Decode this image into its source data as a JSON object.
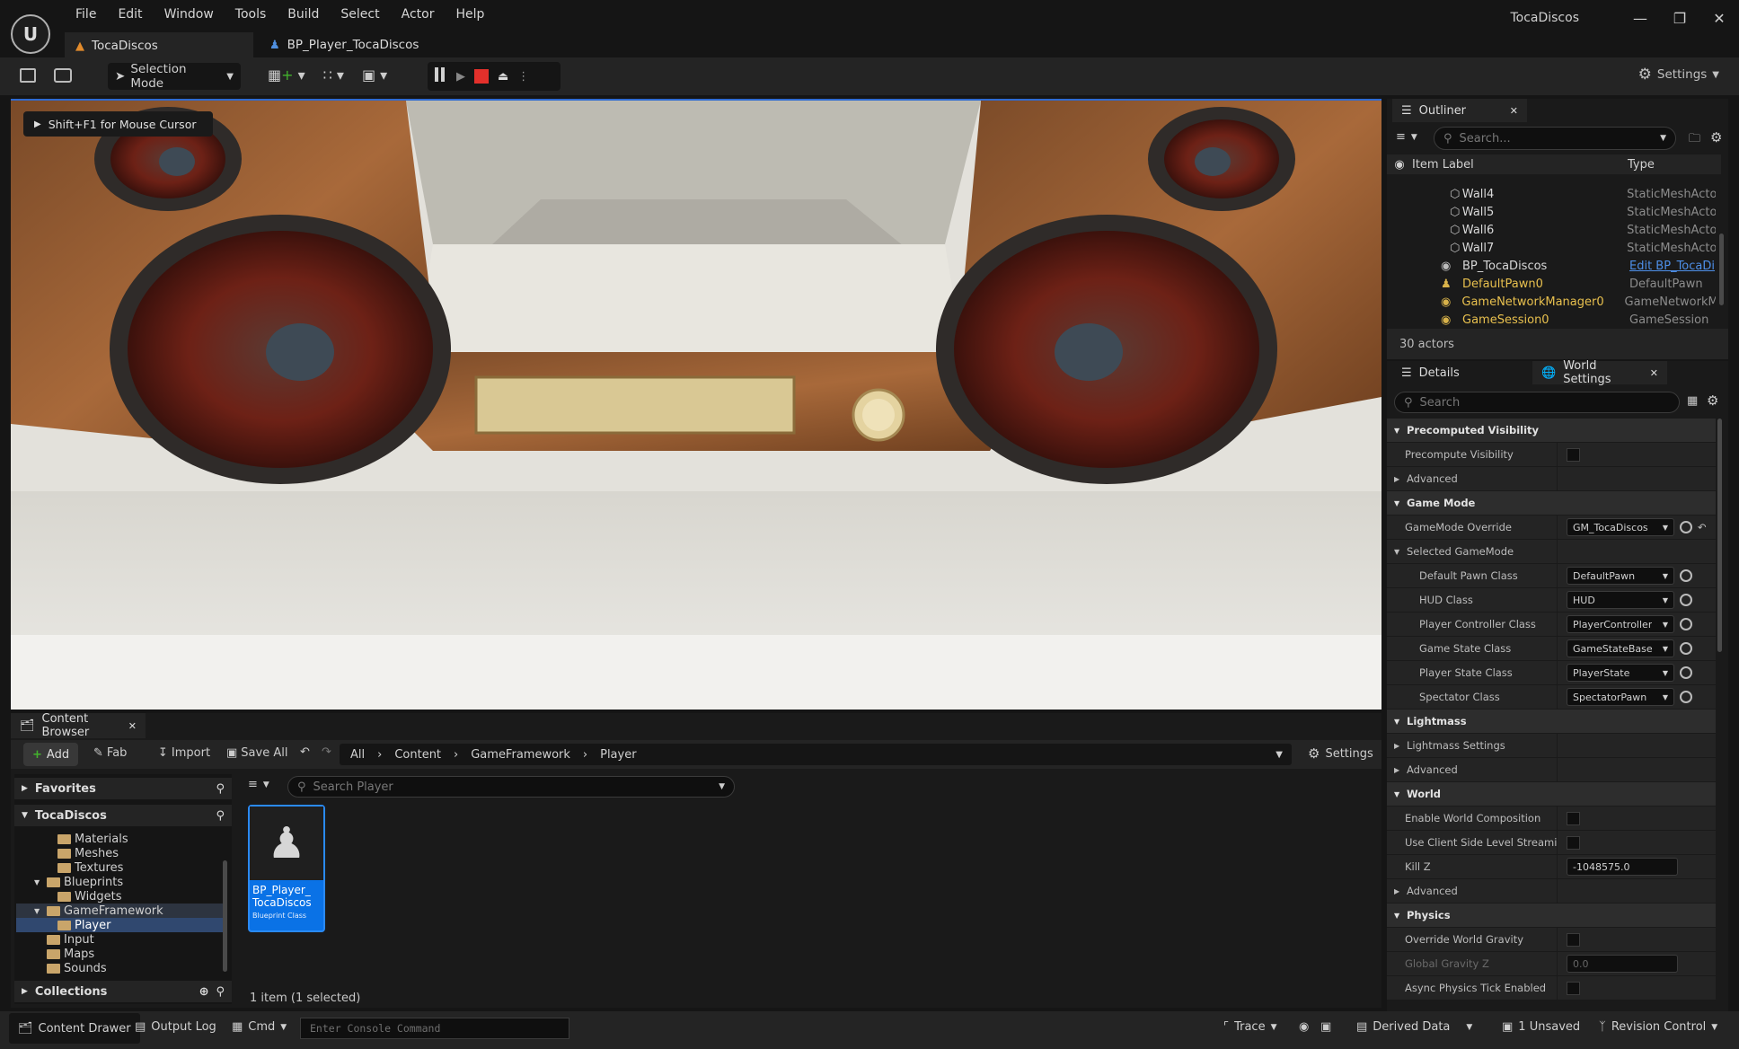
{
  "app": {
    "title": "TocaDiscos",
    "menu": [
      "File",
      "Edit",
      "Window",
      "Tools",
      "Build",
      "Select",
      "Actor",
      "Help"
    ],
    "logo": "unreal-logo"
  },
  "tabs": [
    {
      "label": "TocaDiscos",
      "icon": "level-icon",
      "active": true
    },
    {
      "label": "BP_Player_TocaDiscos",
      "icon": "blueprint-icon",
      "active": false
    }
  ],
  "toolbar": {
    "mode_label": "Selection Mode",
    "settings_label": "Settings"
  },
  "viewport": {
    "hint": "Shift+F1 for Mouse Cursor"
  },
  "outliner": {
    "tab_label": "Outliner",
    "search_placeholder": "Search...",
    "col_label": "Item Label",
    "col_type": "Type",
    "rows": [
      {
        "label": "Wall4",
        "type": "StaticMeshActo"
      },
      {
        "label": "Wall5",
        "type": "StaticMeshActo"
      },
      {
        "label": "Wall6",
        "type": "StaticMeshActo"
      },
      {
        "label": "Wall7",
        "type": "StaticMeshActo"
      },
      {
        "label": "BP_TocaDiscos",
        "type": "Edit BP_TocaDi"
      },
      {
        "label": "DefaultPawn0",
        "type": "DefaultPawn"
      },
      {
        "label": "GameNetworkManager0",
        "type": "GameNetworkM"
      },
      {
        "label": "GameSession0",
        "type": "GameSession"
      }
    ],
    "count": "30 actors"
  },
  "details": {
    "tab_details": "Details",
    "tab_world": "World Settings",
    "search_placeholder": "Search",
    "rows": [
      {
        "kind": "section",
        "label": "Precomputed Visibility"
      },
      {
        "kind": "check",
        "label": "Precompute Visibility"
      },
      {
        "kind": "collapsed",
        "label": "Advanced"
      },
      {
        "kind": "section",
        "label": "Game Mode"
      },
      {
        "kind": "dropdown",
        "label": "GameMode Override",
        "value": "GM_TocaDiscos"
      },
      {
        "kind": "group",
        "label": "Selected GameMode"
      },
      {
        "kind": "dropdown",
        "label": "Default Pawn Class",
        "value": "DefaultPawn",
        "indent": true
      },
      {
        "kind": "dropdown",
        "label": "HUD Class",
        "value": "HUD",
        "indent": true
      },
      {
        "kind": "dropdown",
        "label": "Player Controller Class",
        "value": "PlayerController",
        "indent": true
      },
      {
        "kind": "dropdown",
        "label": "Game State Class",
        "value": "GameStateBase",
        "indent": true
      },
      {
        "kind": "dropdown",
        "label": "Player State Class",
        "value": "PlayerState",
        "indent": true
      },
      {
        "kind": "dropdown",
        "label": "Spectator Class",
        "value": "SpectatorPawn",
        "indent": true
      },
      {
        "kind": "section",
        "label": "Lightmass"
      },
      {
        "kind": "collapsed",
        "label": "Lightmass Settings"
      },
      {
        "kind": "collapsed",
        "label": "Advanced"
      },
      {
        "kind": "section",
        "label": "World"
      },
      {
        "kind": "check",
        "label": "Enable World Composition"
      },
      {
        "kind": "check",
        "label": "Use Client Side Level Streami..."
      },
      {
        "kind": "number",
        "label": "Kill Z",
        "value": "-1048575.0"
      },
      {
        "kind": "collapsed",
        "label": "Advanced"
      },
      {
        "kind": "section",
        "label": "Physics"
      },
      {
        "kind": "check",
        "label": "Override World Gravity"
      },
      {
        "kind": "number",
        "label": "Global Gravity Z",
        "value": "0.0",
        "disabled": true
      },
      {
        "kind": "check",
        "label": "Async Physics Tick Enabled"
      }
    ]
  },
  "content_browser": {
    "tab_label": "Content Browser",
    "add": "Add",
    "fab": "Fab",
    "import": "Import",
    "save_all": "Save All",
    "breadcrumbs": [
      "All",
      "Content",
      "GameFramework",
      "Player"
    ],
    "settings": "Settings",
    "favorites": "Favorites",
    "root": "TocaDiscos",
    "search_placeholder": "Search Player",
    "tree": [
      {
        "label": "Materials",
        "level": 2
      },
      {
        "label": "Meshes",
        "level": 2
      },
      {
        "label": "Textures",
        "level": 2
      },
      {
        "label": "Blueprints",
        "level": 1,
        "open": true
      },
      {
        "label": "Widgets",
        "level": 2
      },
      {
        "label": "GameFramework",
        "level": 1,
        "open": true
      },
      {
        "label": "Player",
        "level": 2,
        "selected": true
      },
      {
        "label": "Input",
        "level": 1
      },
      {
        "label": "Maps",
        "level": 1
      },
      {
        "label": "Sounds",
        "level": 1
      }
    ],
    "collections": "Collections",
    "asset": {
      "name": "BP_Player_\nTocaDiscos",
      "type": "Blueprint Class"
    },
    "item_count": "1 item (1 selected)"
  },
  "status": {
    "content_drawer": "Content Drawer",
    "output_log": "Output Log",
    "cmd": "Cmd",
    "console_placeholder": "Enter Console Command",
    "trace": "Trace",
    "derived_data": "Derived Data",
    "unsaved": "1 Unsaved",
    "revision_control": "Revision Control"
  }
}
